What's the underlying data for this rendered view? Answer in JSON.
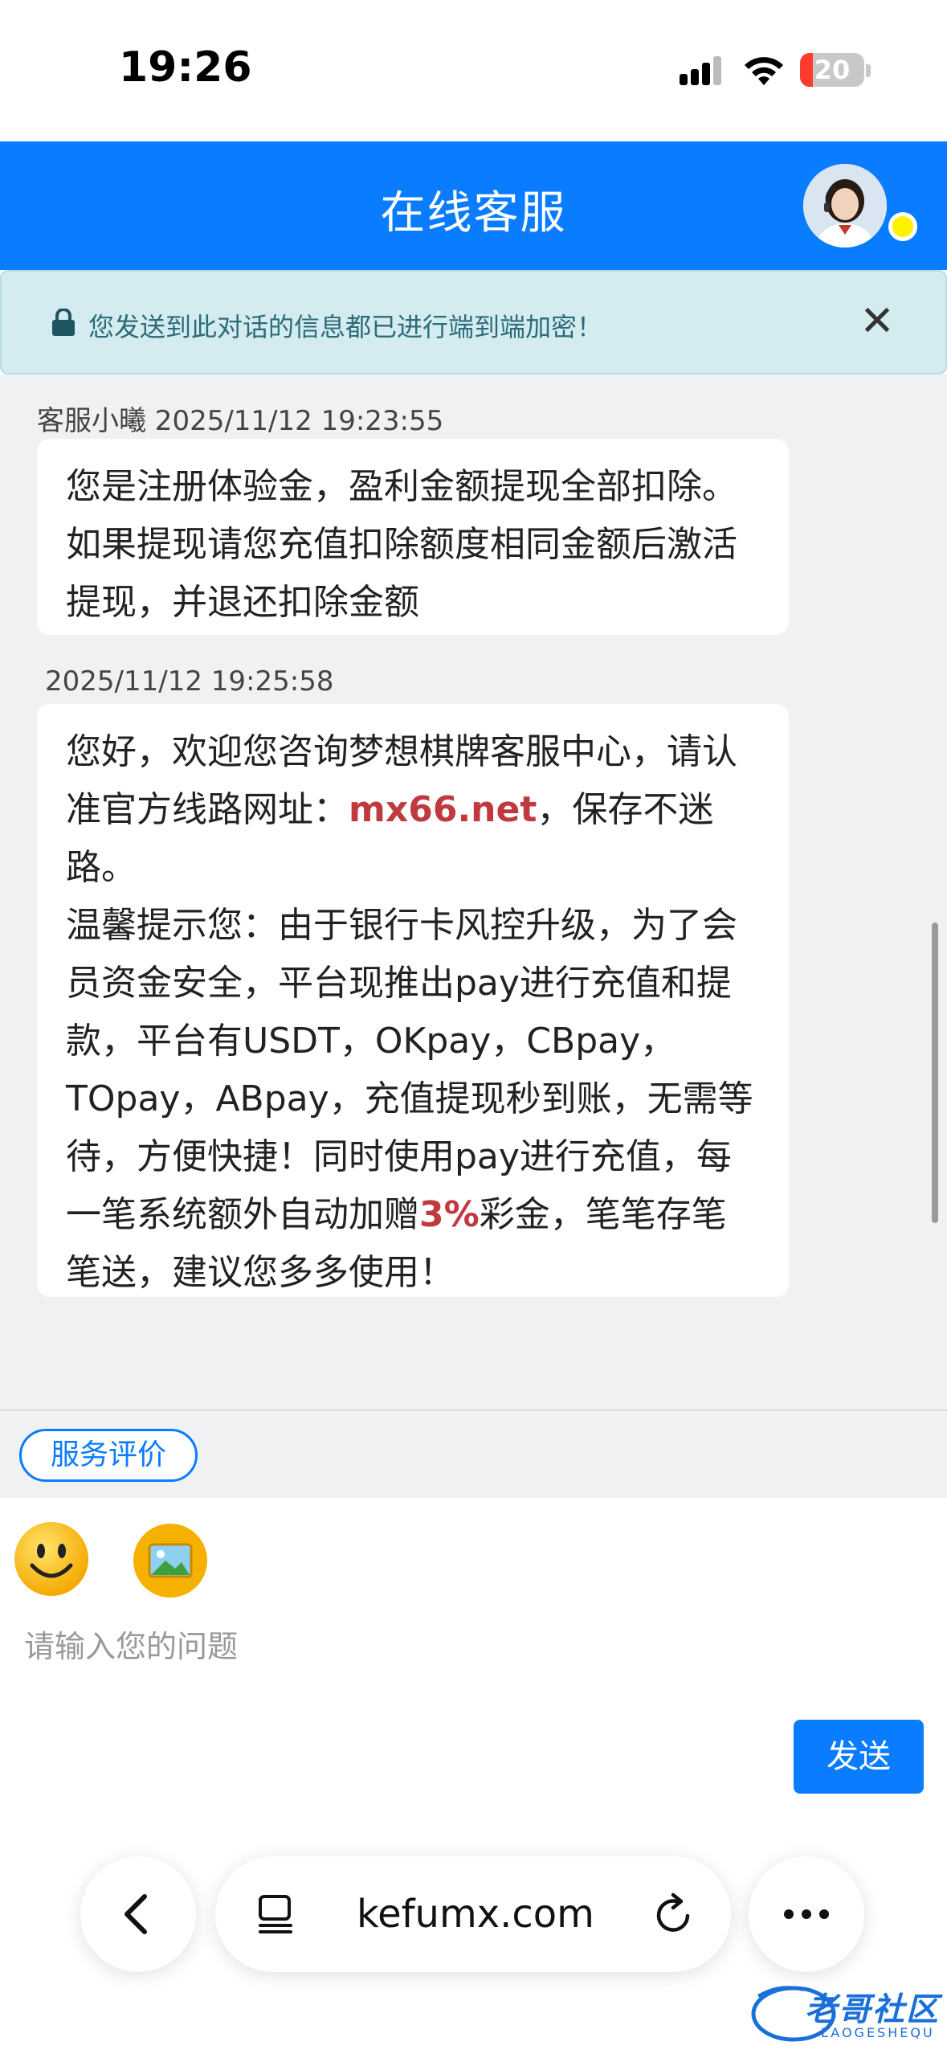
{
  "status_bar": {
    "time": "19:26",
    "battery_level": "20",
    "battery_color": "#ff3b30"
  },
  "header": {
    "title": "在线客服",
    "accent_color": "#0a7cff",
    "online_dot_color": "#fff200"
  },
  "notice": {
    "text": "您发送到此对话的信息都已进行端到端加密！"
  },
  "messages": [
    {
      "meta": "客服小曦 2025/11/12 19:23:55",
      "paragraphs": [
        "您是注册体验金，盈利金额提现全部扣除。如果提现请您充值扣除额度相同金额后激活提现，并退还扣除金额"
      ]
    },
    {
      "meta": "2025/11/12 19:25:58",
      "p1_before": "您好，欢迎您咨询梦想棋牌客服中心，请认准官方线路网址：",
      "p1_link": "mx66.net",
      "p1_after": "，保存不迷路。",
      "p2_before": "温馨提示您：由于银行卡风控升级，为了会员资金安全，平台现推出pay进行充值和提款，平台有USDT，OKpay，CBpay，TOpay，ABpay，充值提现秒到账，无需等待，方便快捷！同时使用pay进行充值，每一笔系统额外自动加赠",
      "p2_highlight": "3%",
      "p2_after": "彩金，笔笔存笔笔送，建议您多多使用！"
    }
  ],
  "rating": {
    "label": "服务评价"
  },
  "input": {
    "placeholder": "请输入您的问题",
    "value": "",
    "send_label": "发送"
  },
  "browser": {
    "url": "kefumx.com"
  },
  "watermark": {
    "text": "老哥社区",
    "sub": "LAOGESHEQU"
  },
  "icons": {
    "emoji": "smiley-face-icon",
    "image": "picture-icon",
    "lock": "lock-icon",
    "close": "close-icon",
    "back": "chevron-left-icon",
    "tabs": "tabs-icon",
    "reload": "reload-icon",
    "more": "more-dots-icon"
  }
}
